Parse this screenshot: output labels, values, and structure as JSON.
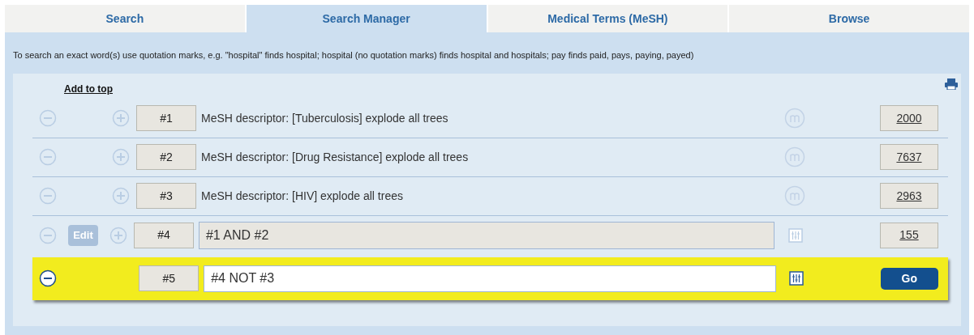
{
  "tabs": [
    {
      "label": "Search",
      "selected": false
    },
    {
      "label": "Search Manager",
      "selected": true
    },
    {
      "label": "Medical Terms (MeSH)",
      "selected": false
    },
    {
      "label": "Browse",
      "selected": false
    }
  ],
  "hint": "To search an exact word(s) use quotation marks, e.g. \"hospital\" finds hospital; hospital (no quotation marks) finds hospital and hospitals; pay finds paid, pays, paying, payed)",
  "add_to_top": "Add to top",
  "rows": [
    {
      "kind": "descriptor",
      "number": "#1",
      "text": "MeSH descriptor: [Tuberculosis] explode all trees",
      "count": "2000"
    },
    {
      "kind": "descriptor",
      "number": "#2",
      "text": "MeSH descriptor: [Drug Resistance] explode all trees",
      "count": "7637"
    },
    {
      "kind": "descriptor",
      "number": "#3",
      "text": "MeSH descriptor: [HIV] explode all trees",
      "count": "2963"
    },
    {
      "kind": "combined",
      "number": "#4",
      "edit": "Edit",
      "value": "#1 AND #2",
      "count": "155"
    },
    {
      "kind": "active",
      "number": "#5",
      "value": "#4 NOT #3",
      "button": "Go"
    }
  ]
}
